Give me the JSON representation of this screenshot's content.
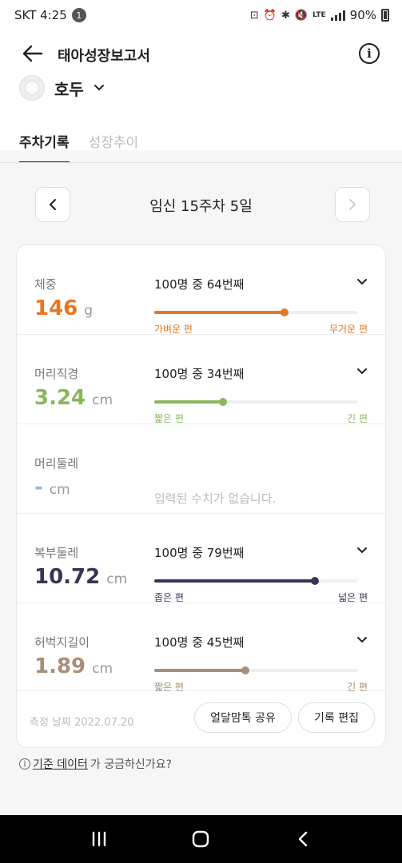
{
  "status_bar": {
    "carrier_time": "SKT 4:25",
    "notification_count": "1",
    "network": "LTE",
    "battery": "90%"
  },
  "header": {
    "title": "태아성장보고서",
    "profile_name": "호두"
  },
  "tabs": [
    {
      "label": "주차기록",
      "active": true
    },
    {
      "label": "성장추이",
      "active": false
    }
  ],
  "week_nav": {
    "label": "임신 15주차 5일"
  },
  "measurements": [
    {
      "label": "체중",
      "value": "146",
      "unit": "g",
      "rank_text": "100명 중 64번째",
      "percentile": 0.64,
      "range_low": "가벼운 편",
      "range_high": "무거운 편",
      "color": "#e87722"
    },
    {
      "label": "머리직경",
      "value": "3.24",
      "unit": "cm",
      "rank_text": "100명 중 34번째",
      "percentile": 0.34,
      "range_low": "짧은 편",
      "range_high": "긴 편",
      "color": "#8bb55a"
    },
    {
      "label": "머리둘레",
      "value": "-",
      "unit": "cm",
      "empty_text": "입력된 수치가 없습니다.",
      "color": "#9fb7d6"
    },
    {
      "label": "복부둘레",
      "value": "10.72",
      "unit": "cm",
      "rank_text": "100명 중 79번째",
      "percentile": 0.79,
      "range_low": "좁은 편",
      "range_high": "넓은 편",
      "color": "#363554"
    },
    {
      "label": "허벅지길이",
      "value": "1.89",
      "unit": "cm",
      "rank_text": "100명 중 45번째",
      "percentile": 0.45,
      "range_low": "짧은 편",
      "range_high": "긴 편",
      "color": "#a88e78"
    }
  ],
  "footer": {
    "measure_date": "측정 날짜 2022.07.20",
    "share_label": "얼달맘톡 공유",
    "edit_label": "기록 편집"
  },
  "help": {
    "link_text": "기준 데이터",
    "rest_text": "가 궁금하신가요?"
  }
}
